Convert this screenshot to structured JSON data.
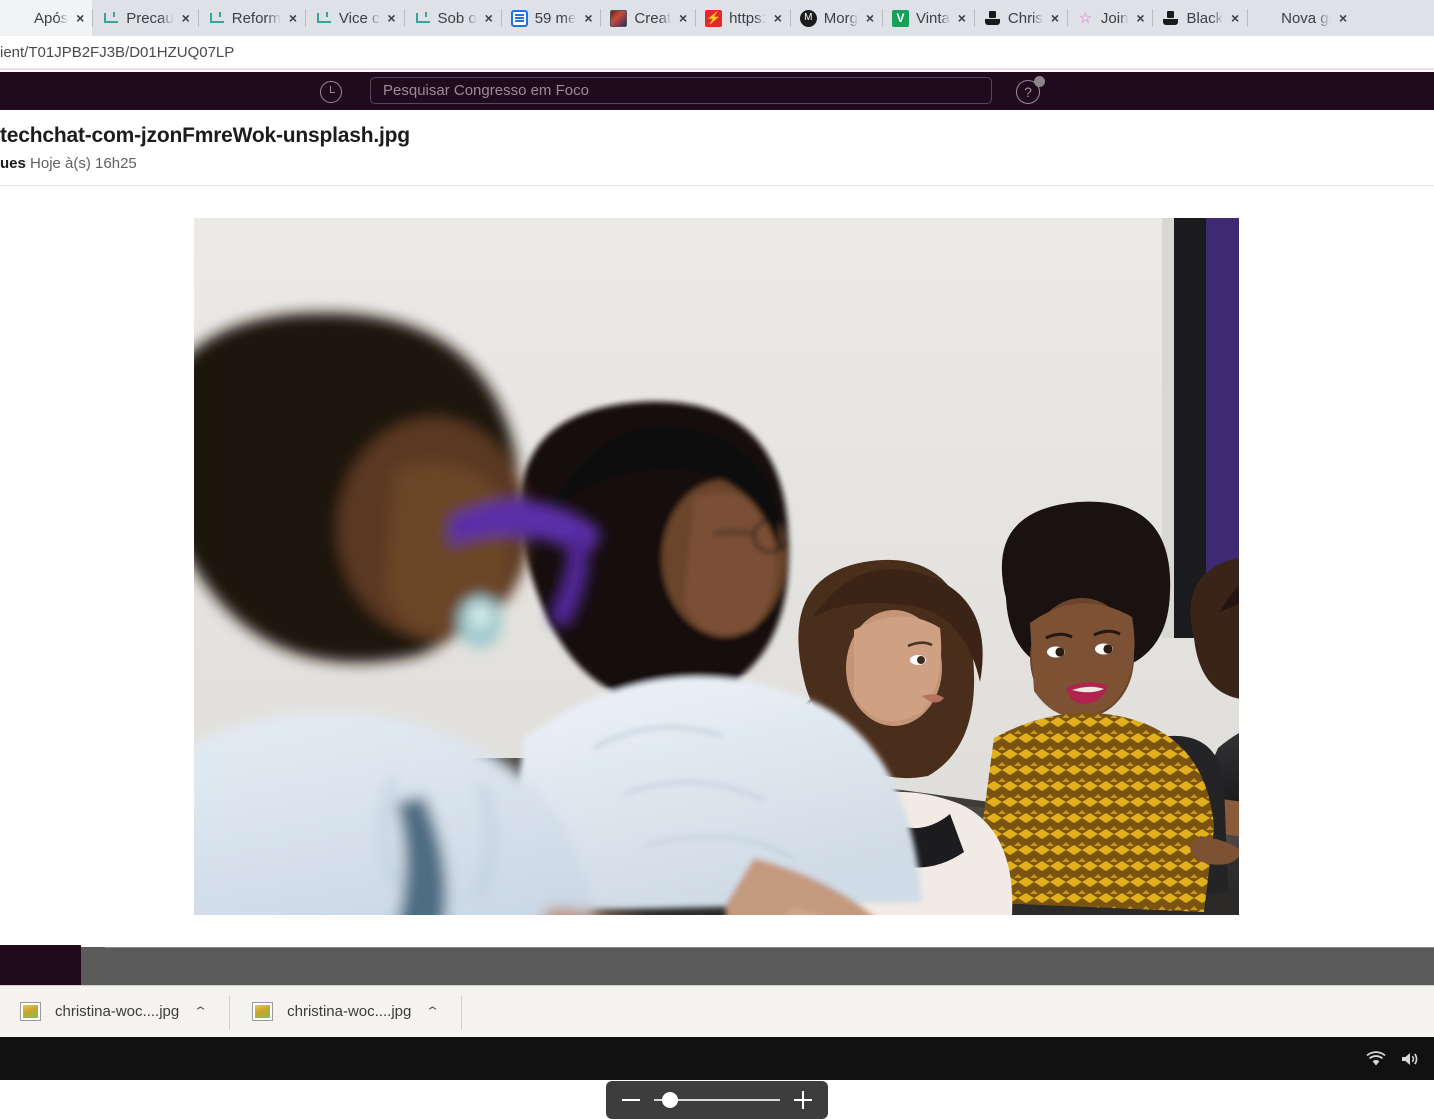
{
  "browser": {
    "tabs": [
      {
        "title": "Após",
        "favicon": "none-icon",
        "close": "×"
      },
      {
        "title": "Precau",
        "favicon": "teal-anchor-icon",
        "close": "×"
      },
      {
        "title": "Reform",
        "favicon": "teal-anchor-icon",
        "close": "×"
      },
      {
        "title": "Vice c",
        "favicon": "teal-anchor-icon",
        "close": "×"
      },
      {
        "title": "Sob o",
        "favicon": "teal-anchor-icon",
        "close": "×"
      },
      {
        "title": "59 me",
        "favicon": "blue-doc-icon",
        "close": "×"
      },
      {
        "title": "Creat",
        "favicon": "photo-thumb-icon",
        "close": "×"
      },
      {
        "title": "https:",
        "favicon": "red-site-icon",
        "close": "×"
      },
      {
        "title": "Morg",
        "favicon": "dark-circle-icon",
        "close": "×"
      },
      {
        "title": "Vinta",
        "favicon": "green-v-icon",
        "close": "×"
      },
      {
        "title": "Chris",
        "favicon": "unsplash-icon",
        "close": "×"
      },
      {
        "title": "Join",
        "favicon": "pink-star-icon",
        "close": "×"
      },
      {
        "title": "Black",
        "favicon": "unsplash-icon",
        "close": "×"
      },
      {
        "title": "Nova gui",
        "favicon": "none-icon",
        "close": "×"
      }
    ],
    "url": "ient/T01JPB2FJ3B/D01HZUQ07LP"
  },
  "slack_header": {
    "history_icon": "clock-history-icon",
    "search_placeholder": "Pesquisar Congresso em Foco",
    "help_icon": "help-question-icon"
  },
  "file": {
    "name": "techchat-com-jzonFmreWok-unsplash.jpg",
    "author": "ues",
    "timestamp": "Hoje à(s) 16h25"
  },
  "viewer": {
    "zoom": {
      "minus_label": "−",
      "plus_label": "+",
      "value": 12
    },
    "image_alt": "Five women seated around a dark conference table in a bright meeting room"
  },
  "downloads": [
    {
      "name": "christina-woc....jpg",
      "icon": "image-file-icon",
      "caret": "⌃"
    },
    {
      "name": "christina-woc....jpg",
      "icon": "image-file-icon",
      "caret": "⌃"
    }
  ],
  "taskbar": {
    "wifi_icon": "wifi-icon",
    "volume_icon": "volume-icon"
  },
  "colors": {
    "slack_header_bg": "#1f0a1e",
    "tabstrip_bg": "#dee1e6",
    "shelf_bg": "#f5f3f0",
    "taskbar_bg": "#111111"
  }
}
